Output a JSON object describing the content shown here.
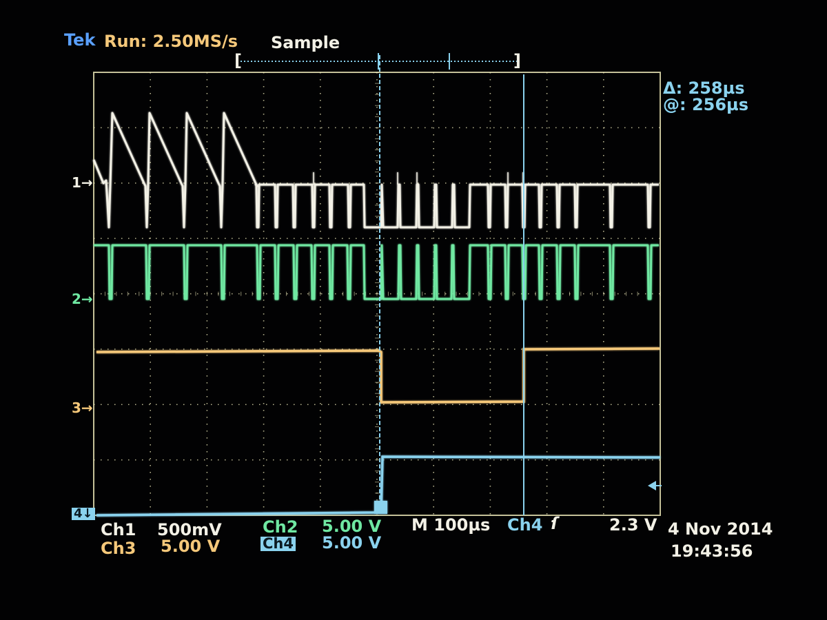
{
  "header": {
    "brand": "Tek",
    "run_status": "Run: 2.50MS/s",
    "acq_mode": "Sample"
  },
  "cursor_readout": {
    "delta": "Δ: 258µs",
    "at": "@: 256µs"
  },
  "channel_markers": {
    "ch1": "1",
    "ch2": "2",
    "ch3": "3",
    "ch4": "4"
  },
  "bottom_bar": {
    "ch1_label": "Ch1",
    "ch1_scale": "500mV",
    "ch2_label": "Ch2",
    "ch2_scale": "5.00 V",
    "ch3_label": "Ch3",
    "ch3_scale": "5.00 V",
    "ch4_label": "Ch4",
    "ch4_scale": "5.00 V",
    "timebase": "M 100µs",
    "trigger_source": "Ch4",
    "trigger_slope": "ſ",
    "trigger_level": "2.3 V",
    "date": "4 Nov 2014",
    "time": "19:43:56"
  },
  "colors": {
    "ch1": "#f3f1e6",
    "ch2": "#6fe8a2",
    "ch3": "#f5c87a",
    "ch4": "#8ad2ee",
    "grid": "#e7e3b4",
    "background": "#020203"
  },
  "chart_data": {
    "type": "line",
    "timebase_per_div": "100µs",
    "x_divisions": 10,
    "y_divisions": 8,
    "series": [
      {
        "name": "Ch1",
        "scale_per_div": "500mV",
        "waveform": "sawtooth bursts then pulse train",
        "sawtooth_peaks_count": 4
      },
      {
        "name": "Ch2",
        "scale_per_div": "5.00 V",
        "waveform": "pulse train"
      },
      {
        "name": "Ch3",
        "scale_per_div": "5.00 V",
        "waveform": "high, low step at trigger, high after cursor"
      },
      {
        "name": "Ch4",
        "scale_per_div": "5.00 V",
        "waveform": "low then rising edge at trigger"
      }
    ],
    "cursors": {
      "delta_us": 258,
      "at_us": 256
    }
  }
}
